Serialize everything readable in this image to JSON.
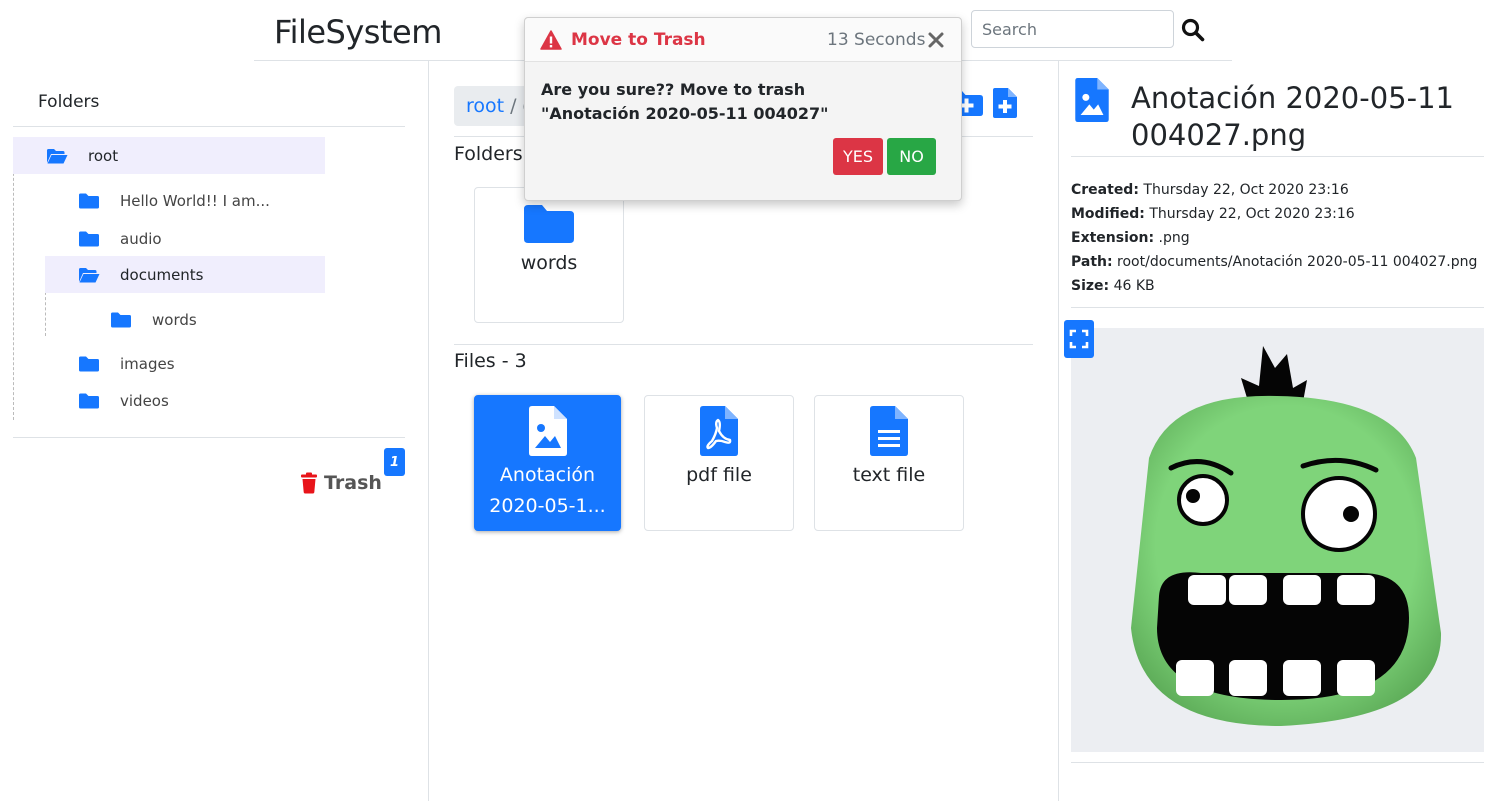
{
  "header": {
    "title": "FileSystem",
    "search_placeholder": "Search"
  },
  "sidebar": {
    "heading": "Folders",
    "tree": [
      {
        "label": "root",
        "level": 0,
        "open": true,
        "active": true
      },
      {
        "label": "Hello World!! I am...",
        "level": 1,
        "open": false,
        "active": false
      },
      {
        "label": "audio",
        "level": 1,
        "open": false,
        "active": false
      },
      {
        "label": "documents",
        "level": 1,
        "open": true,
        "active": true
      },
      {
        "label": "words",
        "level": 2,
        "open": false,
        "active": false
      },
      {
        "label": "images",
        "level": 1,
        "open": false,
        "active": false
      },
      {
        "label": "videos",
        "level": 1,
        "open": false,
        "active": false
      }
    ],
    "trash_label": "Trash",
    "trash_count": "1"
  },
  "main": {
    "breadcrumb": [
      "root",
      "documents"
    ],
    "breadcrumb_sep": "/",
    "folders_title": "Folders - 1",
    "folders": [
      {
        "label": "words"
      }
    ],
    "files_title": "Files - 3",
    "files": [
      {
        "label": "Anotación 2020-05-1...",
        "kind": "image",
        "selected": true
      },
      {
        "label": "pdf file",
        "kind": "pdf",
        "selected": false
      },
      {
        "label": "text file",
        "kind": "text",
        "selected": false
      }
    ]
  },
  "details": {
    "title": "Anotación 2020-05-11 004027.png",
    "meta": [
      {
        "key": "Created:",
        "value": "Thursday 22, Oct 2020 23:16"
      },
      {
        "key": "Modified:",
        "value": "Thursday 22, Oct 2020 23:16"
      },
      {
        "key": "Extension:",
        "value": ".png"
      },
      {
        "key": "Path:",
        "value": "root/documents/Anotación 2020-05-11 004027.png"
      },
      {
        "key": "Size:",
        "value": "46 KB"
      }
    ]
  },
  "toast": {
    "title": "Move to Trash",
    "timer": "13 Seconds",
    "message": "Are you sure?? Move to trash \"Anotación 2020-05-11 004027\"",
    "yes_label": "YES",
    "no_label": "NO"
  },
  "colors": {
    "accent": "#1677ff",
    "danger": "#dc3545",
    "success": "#28a745",
    "tree_active_bg": "#f0eefd"
  },
  "icons": {
    "search": "search-icon",
    "folder": "folder-icon",
    "folder_open": "folder-open-icon",
    "trash": "trash-icon",
    "image_file": "image-file-icon",
    "pdf_file": "pdf-file-icon",
    "text_file": "text-file-icon",
    "warning": "warning-icon",
    "close": "close-icon",
    "expand": "expand-icon",
    "new_folder": "new-folder-icon",
    "new_file": "new-file-icon"
  }
}
